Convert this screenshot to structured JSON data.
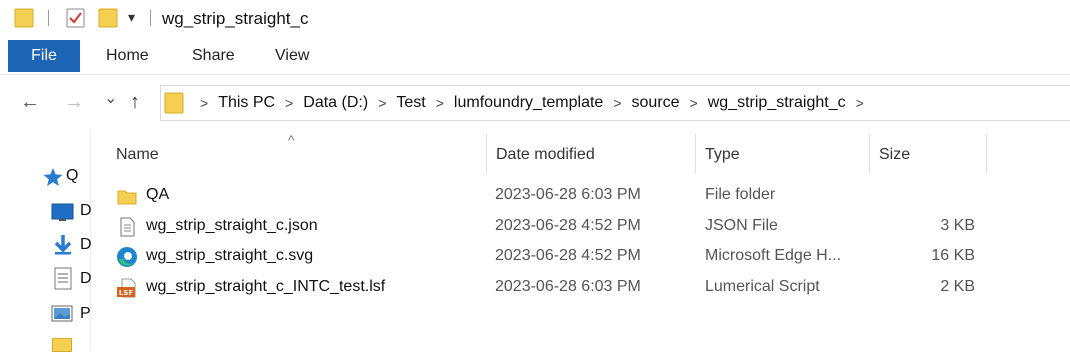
{
  "window": {
    "title": "wg_strip_straight_c",
    "qat_dropdown_glyph": "▾"
  },
  "ribbon": {
    "tabs": [
      {
        "label": "File",
        "active": true
      },
      {
        "label": "Home"
      },
      {
        "label": "Share"
      },
      {
        "label": "View"
      }
    ]
  },
  "nav": {
    "back_glyph": "←",
    "forward_glyph": "→",
    "recent_glyph": "⌄",
    "up_glyph": "↑"
  },
  "address": {
    "separator": ">",
    "crumbs": [
      "This PC",
      "Data (D:)",
      "Test",
      "lumfoundry_template",
      "source",
      "wg_strip_straight_c"
    ]
  },
  "nav_pane": {
    "items": [
      {
        "label": "Q",
        "icon": "star-icon"
      },
      {
        "label": "D",
        "icon": "desktop-icon"
      },
      {
        "label": "D",
        "icon": "download-icon"
      },
      {
        "label": "D",
        "icon": "document-icon"
      },
      {
        "label": "P",
        "icon": "pictures-icon"
      }
    ]
  },
  "columns": {
    "sort_glyph": "^",
    "headers": [
      "Name",
      "Date modified",
      "Type",
      "Size"
    ]
  },
  "files": [
    {
      "name": "QA",
      "date": "2023-06-28 6:03 PM",
      "type": "File folder",
      "size": "",
      "icon": "folder-icon"
    },
    {
      "name": "wg_strip_straight_c.json",
      "date": "2023-06-28 4:52 PM",
      "type": "JSON File",
      "size": "3 KB",
      "icon": "json-file-icon"
    },
    {
      "name": "wg_strip_straight_c.svg",
      "date": "2023-06-28 4:52 PM",
      "type": "Microsoft Edge H...",
      "size": "16 KB",
      "icon": "edge-icon"
    },
    {
      "name": "wg_strip_straight_c_INTC_test.lsf",
      "date": "2023-06-28 6:03 PM",
      "type": "Lumerical Script",
      "size": "2 KB",
      "icon": "lsf-script-icon"
    }
  ],
  "colors": {
    "accent": "#1e64b4",
    "folder": "#f2c94c",
    "folder_dark": "#dcae2c",
    "edge_blue": "#1c86d1",
    "edge_green": "#35c17a",
    "lsf_orange": "#d4631e"
  }
}
